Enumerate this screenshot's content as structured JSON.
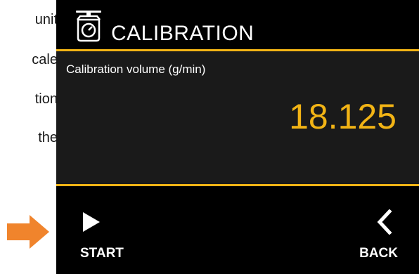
{
  "side_text": [
    "unit",
    "cale",
    "tion",
    "the"
  ],
  "header": {
    "title": "CALIBRATION",
    "icon": "scale-icon"
  },
  "panel": {
    "label": "Calibration volume (g/min)",
    "value": "18.125"
  },
  "buttons": {
    "start_label": "START",
    "back_label": "BACK"
  },
  "colors": {
    "accent": "#f2b415",
    "pointer": "#f0842c",
    "background": "#000000",
    "panel": "#1a1a1a"
  }
}
